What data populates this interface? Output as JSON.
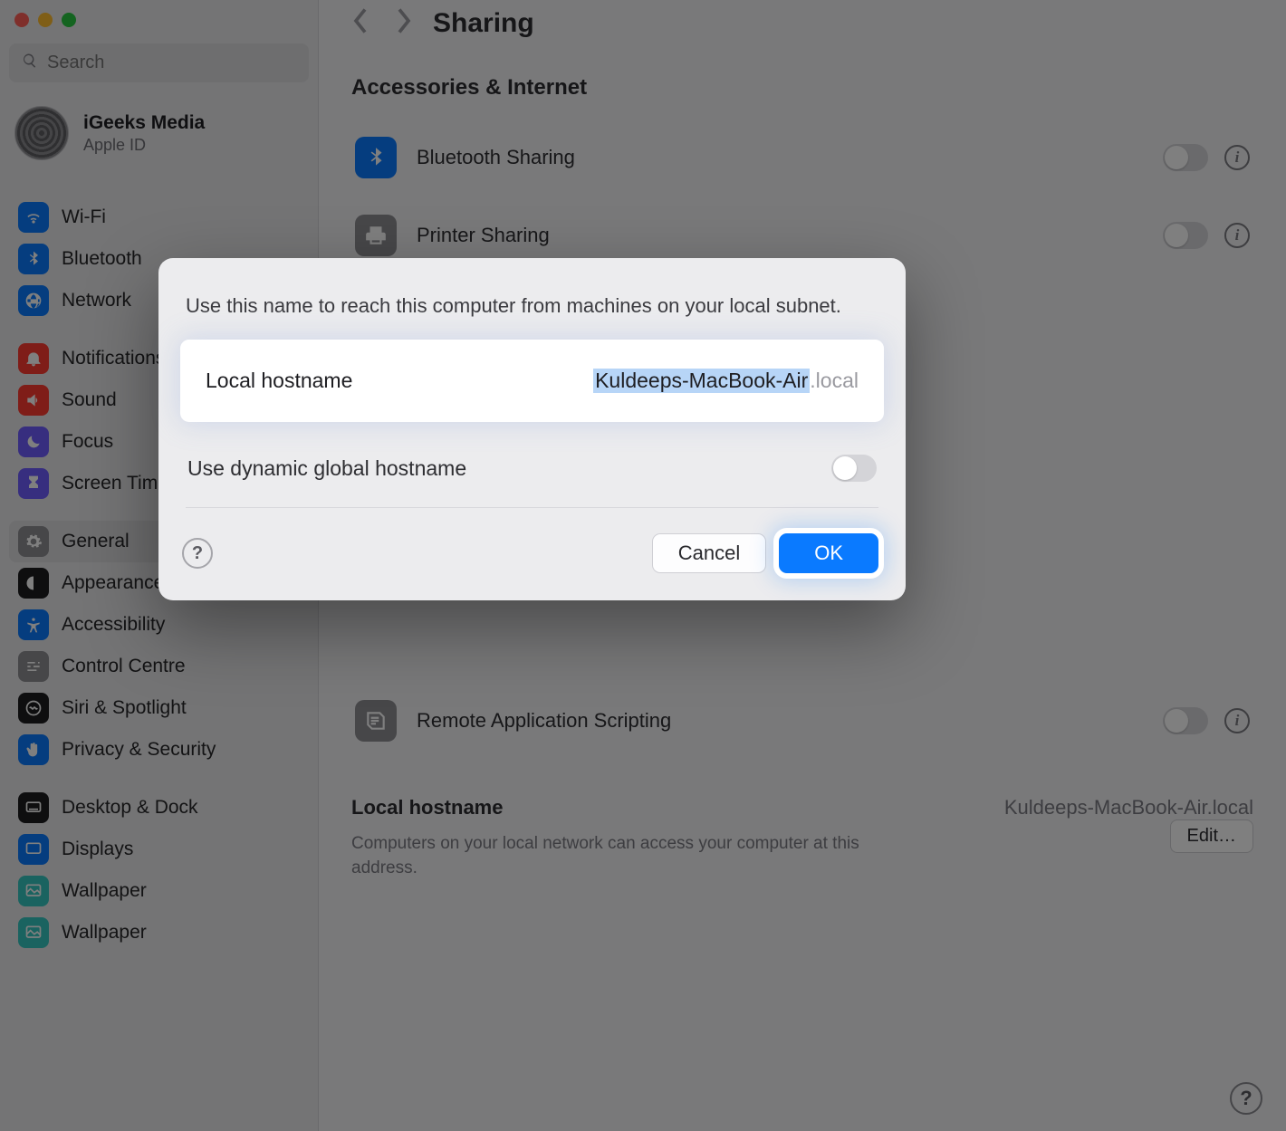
{
  "window": {
    "title": "Sharing"
  },
  "search": {
    "placeholder": "Search"
  },
  "account": {
    "name": "iGeeks Media",
    "sub": "Apple ID"
  },
  "sidebar": {
    "group1": [
      {
        "label": "Wi-Fi",
        "icon": "wifi",
        "color": "#0a7aff"
      },
      {
        "label": "Bluetooth",
        "icon": "bluetooth",
        "color": "#0a7aff"
      },
      {
        "label": "Network",
        "icon": "globe",
        "color": "#0a7aff"
      }
    ],
    "group2": [
      {
        "label": "Notifications",
        "icon": "bell",
        "color": "#ff3b30"
      },
      {
        "label": "Sound",
        "icon": "sound",
        "color": "#ff3b30"
      },
      {
        "label": "Focus",
        "icon": "moon",
        "color": "#6f5cff"
      },
      {
        "label": "Screen Time",
        "icon": "hourglass",
        "color": "#6f5cff"
      }
    ],
    "group3": [
      {
        "label": "General",
        "icon": "gear",
        "color": "#8e8e93",
        "selected": true
      },
      {
        "label": "Appearance",
        "icon": "appear",
        "color": "#1c1c1e"
      },
      {
        "label": "Accessibility",
        "icon": "access",
        "color": "#0a7aff"
      },
      {
        "label": "Control Centre",
        "icon": "sliders",
        "color": "#8e8e93"
      },
      {
        "label": "Siri & Spotlight",
        "icon": "siri",
        "color": "#1c1c1e"
      },
      {
        "label": "Privacy & Security",
        "icon": "hand",
        "color": "#0a7aff"
      }
    ],
    "group4": [
      {
        "label": "Desktop & Dock",
        "icon": "dock",
        "color": "#1c1c1e"
      },
      {
        "label": "Displays",
        "icon": "display",
        "color": "#0a7aff"
      },
      {
        "label": "Wallpaper",
        "icon": "wall",
        "color": "#34c7c0"
      },
      {
        "label": "Wallpaper",
        "icon": "wall",
        "color": "#34c7c0"
      }
    ]
  },
  "main": {
    "section_title": "Accessories & Internet",
    "rows": [
      {
        "label": "Bluetooth Sharing",
        "icon": "bluetooth",
        "color": "#0a7aff"
      },
      {
        "label": "Printer Sharing",
        "icon": "printer",
        "color": "#8e8e93"
      },
      {
        "label": "Remote Application Scripting",
        "icon": "script",
        "color": "#8e8e93"
      }
    ],
    "hostname": {
      "label": "Local hostname",
      "value": "Kuldeeps-MacBook-Air.local",
      "desc": "Computers on your local network can access your computer at this address.",
      "edit": "Edit…"
    }
  },
  "modal": {
    "desc": "Use this name to reach this computer from machines on your local subnet.",
    "field_label": "Local hostname",
    "field_value": "Kuldeeps-MacBook-Air",
    "field_suffix": ".local",
    "dyn_label": "Use dynamic global hostname",
    "cancel": "Cancel",
    "ok": "OK"
  }
}
